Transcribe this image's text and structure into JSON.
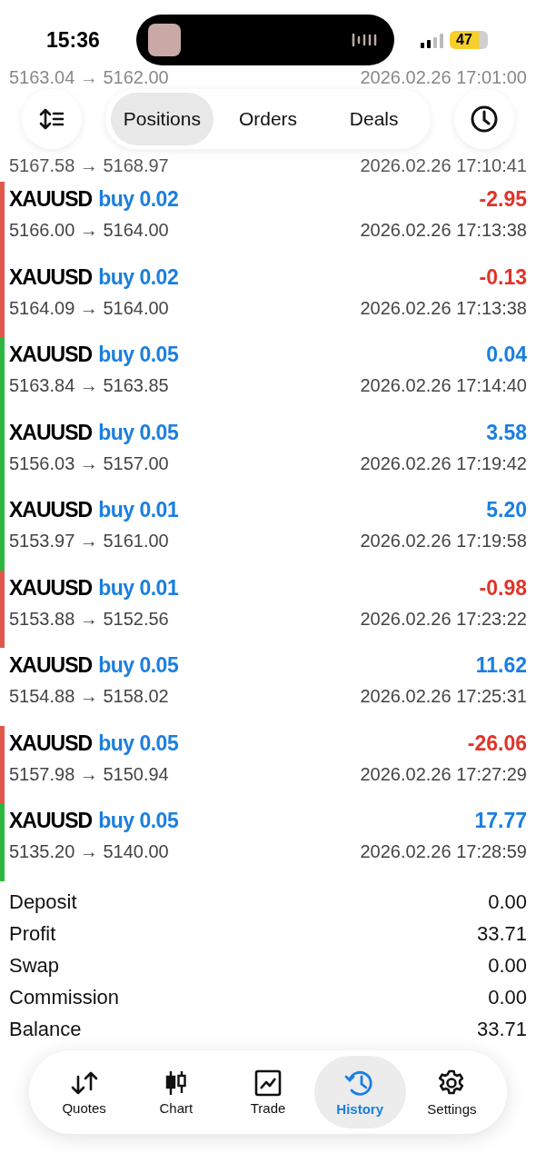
{
  "status_bar": {
    "time": "15:36",
    "battery": "47"
  },
  "header": {
    "tabs": [
      {
        "label": "Positions",
        "selected": true
      },
      {
        "label": "Orders",
        "selected": false
      },
      {
        "label": "Deals",
        "selected": false
      }
    ]
  },
  "background_rows": [
    {
      "prices": "5163.04 → 5162.00",
      "time": "2026.02.26 17:01:00"
    },
    {
      "prices": "5167.58 → 5168.97",
      "time": "2026.02.26 17:10:41"
    }
  ],
  "deals": [
    {
      "symbol": "XAUUSD",
      "side": "buy 0.02",
      "profit": "-2.95",
      "kind": "loss",
      "prices": "5166.00 → 5164.00",
      "time": "2026.02.26 17:13:38",
      "color": "#e0584c"
    },
    {
      "symbol": "XAUUSD",
      "side": "buy 0.02",
      "profit": "-0.13",
      "kind": "loss",
      "prices": "5164.09 → 5164.00",
      "time": "2026.02.26 17:13:38",
      "color": "#e0584c"
    },
    {
      "symbol": "XAUUSD",
      "side": "buy 0.05",
      "profit": "0.04",
      "kind": "profit",
      "prices": "5163.84 → 5163.85",
      "time": "2026.02.26 17:14:40",
      "color": "#2cb840"
    },
    {
      "symbol": "XAUUSD",
      "side": "buy 0.05",
      "profit": "3.58",
      "kind": "profit",
      "prices": "5156.03 → 5157.00",
      "time": "2026.02.26 17:19:42",
      "color": "#2cb840"
    },
    {
      "symbol": "XAUUSD",
      "side": "buy 0.01",
      "profit": "5.20",
      "kind": "profit",
      "prices": "5153.97 → 5161.00",
      "time": "2026.02.26 17:19:58",
      "color": "#2cb840"
    },
    {
      "symbol": "XAUUSD",
      "side": "buy 0.01",
      "profit": "-0.98",
      "kind": "loss",
      "prices": "5153.88 → 5152.56",
      "time": "2026.02.26 17:23:22",
      "color": "#e0584c"
    },
    {
      "symbol": "XAUUSD",
      "side": "buy 0.05",
      "profit": "11.62",
      "kind": "profit",
      "prices": "5154.88 → 5158.02",
      "time": "2026.02.26 17:25:31"
    },
    {
      "symbol": "XAUUSD",
      "side": "buy 0.05",
      "profit": "-26.06",
      "kind": "loss",
      "prices": "5157.98 → 5150.94",
      "time": "2026.02.26 17:27:29",
      "color": "#e0584c"
    },
    {
      "symbol": "XAUUSD",
      "side": "buy 0.05",
      "profit": "17.77",
      "kind": "profit",
      "prices": "5135.20 → 5140.00",
      "time": "2026.02.26 17:28:59",
      "color": "#2cb840"
    }
  ],
  "summary": [
    {
      "label": "Deposit",
      "value": "0.00"
    },
    {
      "label": "Profit",
      "value": "33.71"
    },
    {
      "label": "Swap",
      "value": "0.00"
    },
    {
      "label": "Commission",
      "value": "0.00"
    },
    {
      "label": "Balance",
      "value": "33.71"
    }
  ],
  "tab_bar": [
    {
      "label": "Quotes",
      "kind": "quotes",
      "selected": false
    },
    {
      "label": "Chart",
      "kind": "chart",
      "selected": false
    },
    {
      "label": "Trade",
      "kind": "trade",
      "selected": false
    },
    {
      "label": "History",
      "kind": "history",
      "selected": true
    },
    {
      "label": "Settings",
      "kind": "settings",
      "selected": false
    }
  ]
}
